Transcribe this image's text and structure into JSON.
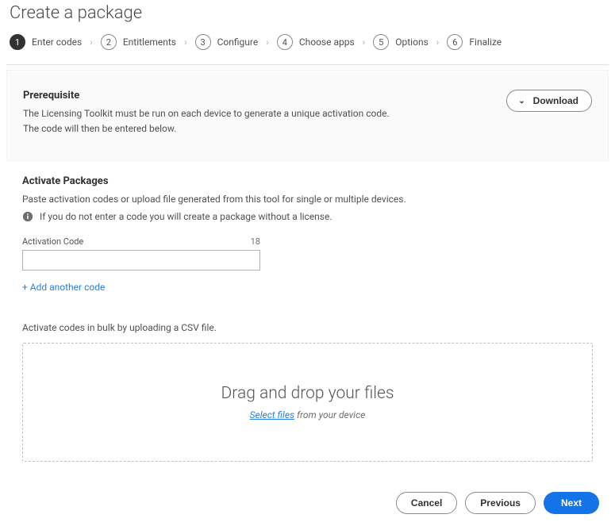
{
  "page": {
    "title": "Create a package"
  },
  "stepper": {
    "steps": [
      {
        "num": "1",
        "label": "Enter codes"
      },
      {
        "num": "2",
        "label": "Entitlements"
      },
      {
        "num": "3",
        "label": "Configure"
      },
      {
        "num": "4",
        "label": "Choose apps"
      },
      {
        "num": "5",
        "label": "Options"
      },
      {
        "num": "6",
        "label": "Finalize"
      }
    ]
  },
  "prereq": {
    "title": "Prerequisite",
    "desc": "The Licensing Toolkit must be run on each device to generate a unique activation code. The code will then be entered below.",
    "download_label": "Download"
  },
  "activate": {
    "title": "Activate Packages",
    "desc": "Paste activation codes or upload file generated from this tool for single or multiple devices.",
    "info": "If you do not enter a code you will create a package without a license.",
    "field_label": "Activation Code",
    "field_max": "18",
    "field_value": "",
    "add_another": "+ Add another code",
    "bulk_text": "Activate codes in bulk by uploading a CSV file.",
    "dz_title": "Drag and drop your files",
    "dz_select": "Select files",
    "dz_suffix": " from your device"
  },
  "footer": {
    "cancel": "Cancel",
    "previous": "Previous",
    "next": "Next"
  }
}
